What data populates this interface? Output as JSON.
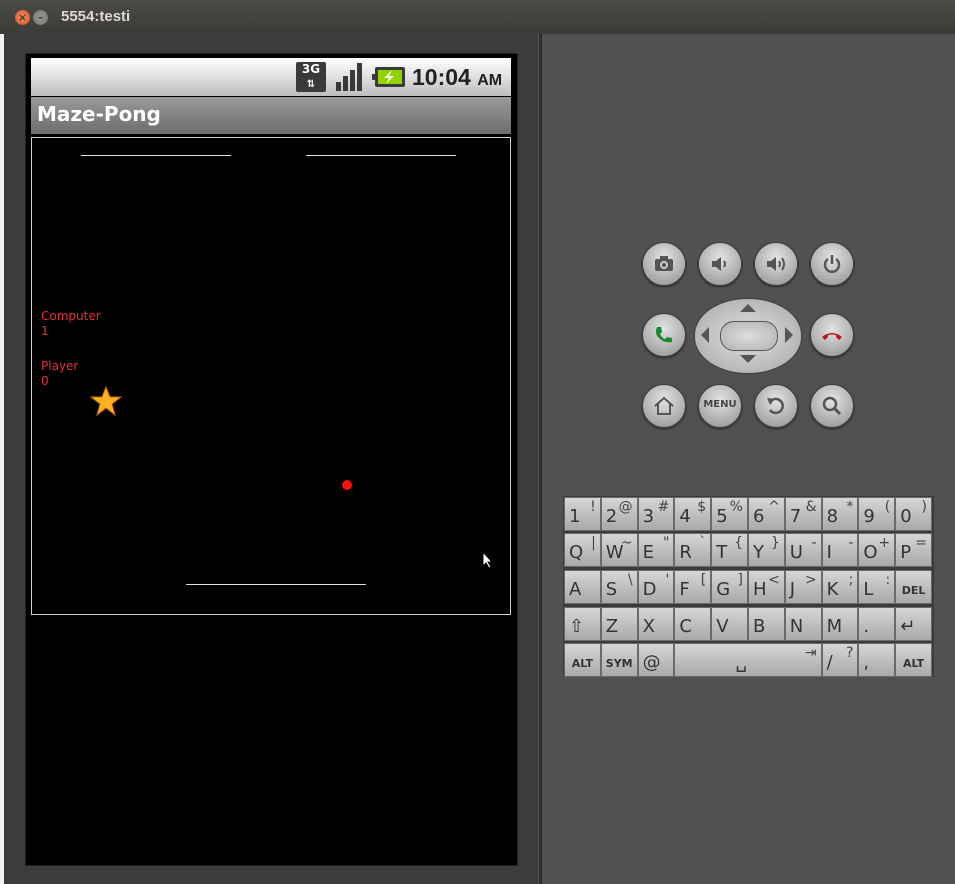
{
  "window": {
    "title": "5554:testi"
  },
  "statusbar": {
    "network": "3G",
    "time": "10:04",
    "ampm": "AM"
  },
  "app": {
    "title": "Maze-Pong"
  },
  "game": {
    "computer_label": "Computer",
    "computer_score": "1",
    "player_label": "Player",
    "player_score": "0"
  },
  "controls": {
    "menu_label": "MENU"
  },
  "keyboard": {
    "row1": [
      [
        "1",
        "!"
      ],
      [
        "2",
        "@"
      ],
      [
        "3",
        "#"
      ],
      [
        "4",
        "$"
      ],
      [
        "5",
        "%"
      ],
      [
        "6",
        "^"
      ],
      [
        "7",
        "&"
      ],
      [
        "8",
        "*"
      ],
      [
        "9",
        "("
      ],
      [
        "0",
        ")"
      ]
    ],
    "row2": [
      [
        "Q",
        "|"
      ],
      [
        "W",
        "~"
      ],
      [
        "E",
        "\""
      ],
      [
        "R",
        "`"
      ],
      [
        "T",
        "{"
      ],
      [
        "Y",
        "}"
      ],
      [
        "U",
        "-"
      ],
      [
        "I",
        "-"
      ],
      [
        "O",
        "+"
      ],
      [
        "P",
        "="
      ]
    ],
    "row3": [
      [
        "A",
        ""
      ],
      [
        "S",
        "\\"
      ],
      [
        "D",
        "'"
      ],
      [
        "F",
        "["
      ],
      [
        "G",
        "]"
      ],
      [
        "H",
        "<"
      ],
      [
        "J",
        ">"
      ],
      [
        "K",
        ";"
      ],
      [
        "L",
        ":"
      ]
    ],
    "row4": [
      [
        "Z",
        ""
      ],
      [
        "X",
        ""
      ],
      [
        "C",
        ""
      ],
      [
        "V",
        ""
      ],
      [
        "B",
        ""
      ],
      [
        "N",
        ""
      ],
      [
        "M",
        ""
      ],
      [
        ".",
        ""
      ]
    ],
    "del_label": "DEL",
    "alt_label": "ALT",
    "sym_label": "SYM",
    "at_label": "@",
    "slash": [
      "/",
      "?"
    ],
    "comma": ","
  }
}
